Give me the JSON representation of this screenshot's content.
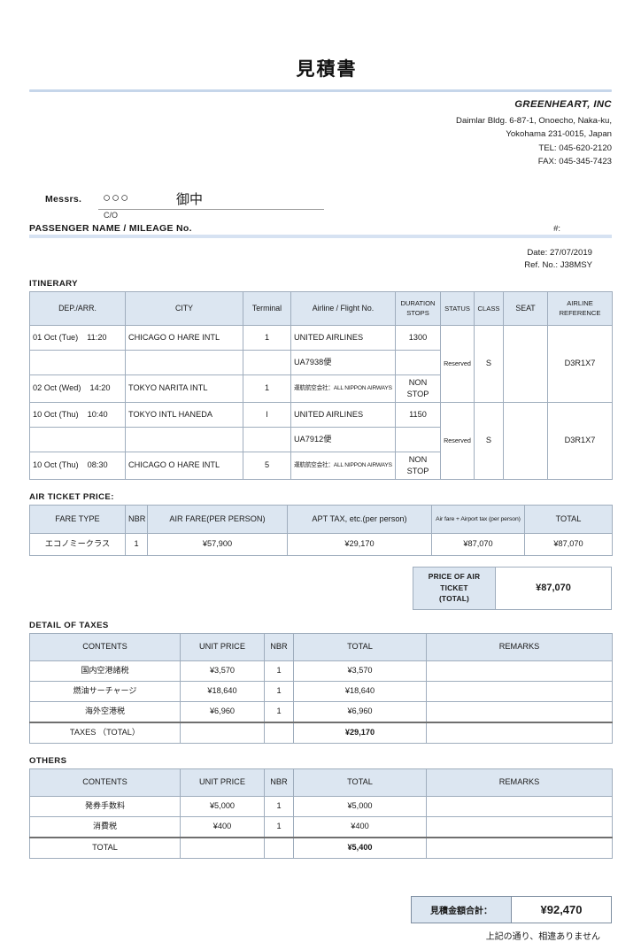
{
  "document": {
    "title": "見積書",
    "company": {
      "name": "GREENHEART, INC",
      "address_line1": "Daimlar Bldg. 6-87-1, Onoecho, Naka-ku,",
      "address_line2": "Yokohama 231-0015, Japan",
      "tel": "TEL: 045-620-2120",
      "fax": "FAX: 045-345-7423"
    },
    "addressee": {
      "messrs_label": "Messrs.",
      "name_placeholder": "○○○",
      "honorific": "御中",
      "co_label": "C/O",
      "passenger_line": "PASSENGER NAME  /   MILEAGE No.",
      "hash_label": "#:"
    },
    "meta": {
      "date": "Date: 27/07/2019",
      "ref_no": "Ref. No.: J38MSY"
    }
  },
  "itinerary": {
    "section_label": "ITINERARY",
    "headers": {
      "dep_arr": "DEP./ARR.",
      "city": "CITY",
      "terminal": "Terminal",
      "airline_flight": "Airline / Flight No.",
      "duration": "DURATION",
      "stops": "STOPS",
      "status": "STATUS",
      "class": "CLASS",
      "seat": "SEAT",
      "airline_reference_l1": "AIRLINE",
      "airline_reference_l2": "REFERENCE"
    },
    "segments": [
      {
        "dep_date": "01 Oct (Tue)",
        "dep_time": "11:20",
        "dep_city": "CHICAGO O HARE INTL",
        "dep_terminal": "1",
        "arr_date": "02 Oct (Wed)",
        "arr_time": "14:20",
        "arr_city": "TOKYO NARITA INTL",
        "arr_terminal": "1",
        "airline": "UNITED AIRLINES",
        "flight_no": "UA7938便",
        "operated_by": "運航航空会社：ALL NIPPON AIRWAYS",
        "duration": "1300",
        "stops": "NON STOP",
        "status": "Reserved",
        "class": "S",
        "seat": "",
        "airline_reference": "D3R1X7"
      },
      {
        "dep_date": "10 Oct (Thu)",
        "dep_time": "10:40",
        "dep_city": "TOKYO INTL HANEDA",
        "dep_terminal": "I",
        "arr_date": "10 Oct (Thu)",
        "arr_time": "08:30",
        "arr_city": "CHICAGO O HARE INTL",
        "arr_terminal": "5",
        "airline": "UNITED AIRLINES",
        "flight_no": "UA7912便",
        "operated_by": "運航航空会社：ALL NIPPON AIRWAYS",
        "duration": "1150",
        "stops": "NON STOP",
        "status": "Reserved",
        "class": "S",
        "seat": "",
        "airline_reference": "D3R1X7"
      }
    ]
  },
  "air_ticket_price": {
    "section_label": "AIR TICKET PRICE:",
    "headers": {
      "fare_type": "FARE TYPE",
      "nbr": "NBR",
      "air_fare": "AIR FARE(PER PERSON)",
      "apt_tax": "APT TAX, etc.(per person)",
      "air_fare_plus_tax": "Air fare + Airport tax (per person)",
      "total": "TOTAL"
    },
    "rows": [
      {
        "fare_type": "エコノミークラス",
        "nbr": "1",
        "air_fare": "¥57,900",
        "apt_tax": "¥29,170",
        "air_fare_plus_tax": "¥87,070",
        "total": "¥87,070"
      }
    ],
    "price_of_air_ticket": {
      "label_line1": "PRICE OF AIR",
      "label_line2": "TICKET",
      "label_line3": "(TOTAL)",
      "value": "¥87,070"
    }
  },
  "detail_of_taxes": {
    "section_label": "DETAIL OF TAXES",
    "headers": {
      "contents": "CONTENTS",
      "unit_price": "UNIT PRICE",
      "nbr": "NBR",
      "total": "TOTAL",
      "remarks": "REMARKS"
    },
    "rows": [
      {
        "contents": "国内空港諸税",
        "unit_price": "¥3,570",
        "nbr": "1",
        "total": "¥3,570",
        "remarks": ""
      },
      {
        "contents": "燃油サーチャージ",
        "unit_price": "¥18,640",
        "nbr": "1",
        "total": "¥18,640",
        "remarks": ""
      },
      {
        "contents": "海外空港税",
        "unit_price": "¥6,960",
        "nbr": "1",
        "total": "¥6,960",
        "remarks": ""
      }
    ],
    "total_row": {
      "label": "TAXES （TOTAL）",
      "unit_price": "",
      "nbr": "",
      "total": "¥29,170",
      "remarks": ""
    }
  },
  "others": {
    "section_label": "OTHERS",
    "headers": {
      "contents": "CONTENTS",
      "unit_price": "UNIT PRICE",
      "nbr": "NBR",
      "total": "TOTAL",
      "remarks": "REMARKS"
    },
    "rows": [
      {
        "contents": "発券手数料",
        "unit_price": "¥5,000",
        "nbr": "1",
        "total": "¥5,000",
        "remarks": ""
      },
      {
        "contents": "消費税",
        "unit_price": "¥400",
        "nbr": "1",
        "total": "¥400",
        "remarks": ""
      }
    ],
    "total_row": {
      "label": "TOTAL",
      "unit_price": "",
      "nbr": "",
      "total": "¥5,400",
      "remarks": ""
    }
  },
  "grand_total": {
    "label": "見積金額合計：",
    "value": "¥92,470",
    "note": "上記の通り、相違ありません"
  },
  "colors": {
    "header_fill": "#dce6f1",
    "rule_blue": "#c6d6ea",
    "bar_blue": "#d6e2f2",
    "border": "#9fadbd"
  }
}
